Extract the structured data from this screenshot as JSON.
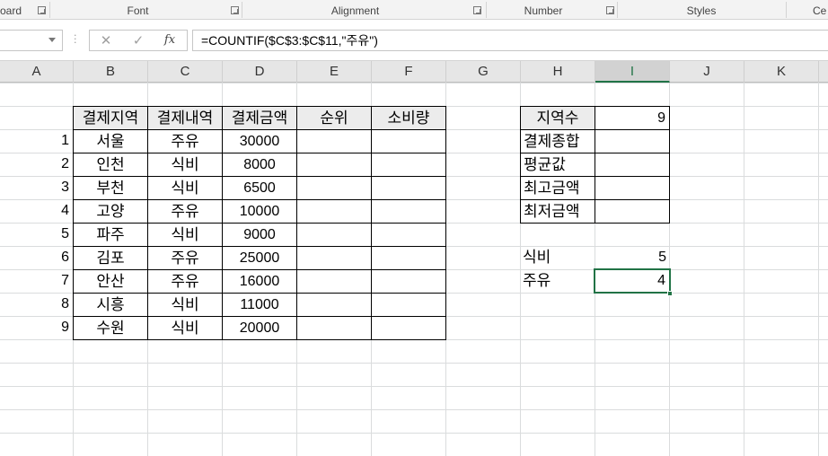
{
  "ribbon": {
    "groups": [
      "oard",
      "Font",
      "Alignment",
      "Number",
      "Styles",
      "Ce"
    ]
  },
  "formula_bar": {
    "name_box": "",
    "cancel_icon": "✕",
    "enter_icon": "✓",
    "fx_label": "fx",
    "formula": "=COUNTIF($C$3:$C$11,\"주유\")"
  },
  "columns": [
    "A",
    "B",
    "C",
    "D",
    "E",
    "F",
    "G",
    "H",
    "I",
    "J",
    "K"
  ],
  "selected_column": "I",
  "main_table": {
    "headers": [
      "결제지역",
      "결제내역",
      "결제금액",
      "순위",
      "소비량"
    ],
    "rows": [
      {
        "no": "1",
        "region": "서울",
        "type": "주유",
        "amount": "30000"
      },
      {
        "no": "2",
        "region": "인천",
        "type": "식비",
        "amount": "8000"
      },
      {
        "no": "3",
        "region": "부천",
        "type": "식비",
        "amount": "6500"
      },
      {
        "no": "4",
        "region": "고양",
        "type": "주유",
        "amount": "10000"
      },
      {
        "no": "5",
        "region": "파주",
        "type": "식비",
        "amount": "9000"
      },
      {
        "no": "6",
        "region": "김포",
        "type": "주유",
        "amount": "25000"
      },
      {
        "no": "7",
        "region": "안산",
        "type": "주유",
        "amount": "16000"
      },
      {
        "no": "8",
        "region": "시흥",
        "type": "식비",
        "amount": "11000"
      },
      {
        "no": "9",
        "region": "수원",
        "type": "식비",
        "amount": "20000"
      }
    ]
  },
  "summary": [
    {
      "label": "지역수",
      "value": "9"
    },
    {
      "label": "결제종합",
      "value": ""
    },
    {
      "label": "평균값",
      "value": ""
    },
    {
      "label": "최고금액",
      "value": ""
    },
    {
      "label": "최저금액",
      "value": ""
    }
  ],
  "counts": [
    {
      "label": "식비",
      "value": "5"
    },
    {
      "label": "주유",
      "value": "4"
    }
  ],
  "colors": {
    "accent": "#217346"
  }
}
